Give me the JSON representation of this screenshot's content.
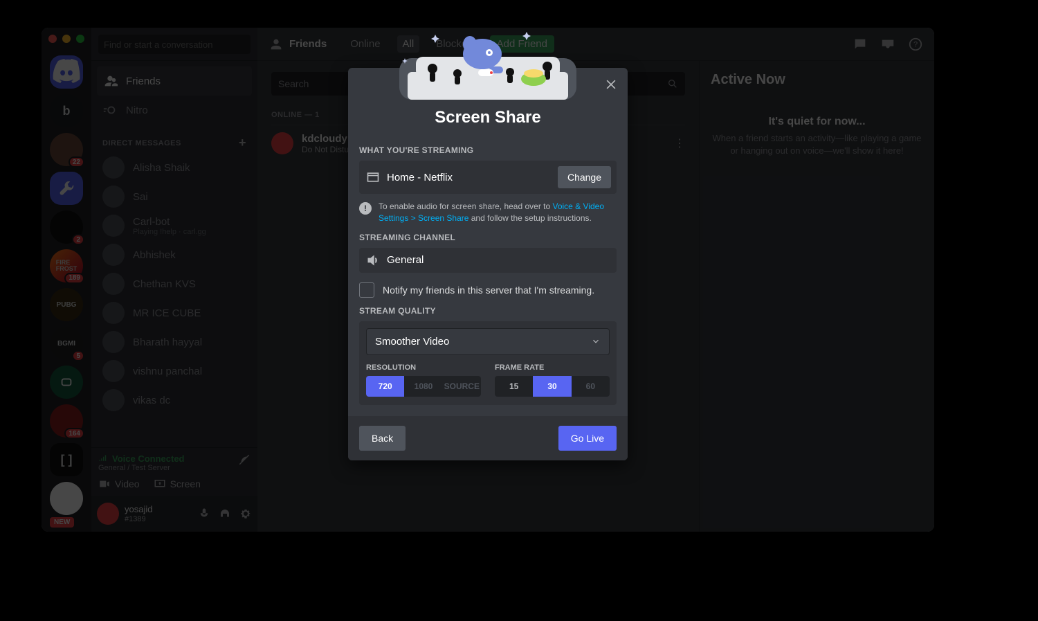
{
  "search_placeholder": "Find or start a conversation",
  "nav": {
    "friends": "Friends",
    "nitro": "Nitro"
  },
  "dm_header": "DIRECT MESSAGES",
  "dms": [
    {
      "name": "Alisha Shaik"
    },
    {
      "name": "Sai"
    },
    {
      "name": "Carl-bot",
      "sub": "Playing !help · carl.gg"
    },
    {
      "name": "Abhishek"
    },
    {
      "name": "Chethan KVS"
    },
    {
      "name": "MR ICE CUBE"
    },
    {
      "name": "Bharath hayyal"
    },
    {
      "name": "vishnu panchal"
    },
    {
      "name": "vikas dc"
    }
  ],
  "guild_badges": [
    "22",
    "2",
    "189",
    "5",
    "164"
  ],
  "new_pill": "NEW",
  "voice": {
    "status": "Voice Connected",
    "sub": "General / Test Server",
    "video": "Video",
    "screen": "Screen"
  },
  "user": {
    "name": "yosajid",
    "tag": "#1389"
  },
  "toolbar": {
    "title": "Friends",
    "tabs": {
      "online": "Online",
      "all": "All",
      "blocked": "Blocked",
      "add": "Add Friend"
    }
  },
  "friends": {
    "search": "Search",
    "online_header": "ONLINE — 1",
    "row": {
      "name": "kdcloudy",
      "status": "Do Not Disturb"
    }
  },
  "active_now": {
    "title": "Active Now",
    "quiet_title": "It's quiet for now...",
    "quiet_body": "When a friend starts an activity—like playing a game or hanging out on voice—we'll show it here!"
  },
  "modal": {
    "title": "Screen Share",
    "streaming_label": "WHAT YOU'RE STREAMING",
    "source": "Home - Netflix",
    "change": "Change",
    "hint_pre": "To enable audio for screen share, head over to ",
    "hint_link": "Voice & Video Settings > Screen Share",
    "hint_post": " and follow the setup instructions.",
    "channel_label": "STREAMING CHANNEL",
    "channel": "General",
    "notify": "Notify my friends in this server that I'm streaming.",
    "quality_label": "STREAM QUALITY",
    "quality_select": "Smoother Video",
    "res_label": "RESOLUTION",
    "fps_label": "FRAME RATE",
    "res": [
      "720",
      "1080",
      "SOURCE"
    ],
    "fps": [
      "15",
      "30",
      "60"
    ],
    "back": "Back",
    "golive": "Go Live"
  }
}
